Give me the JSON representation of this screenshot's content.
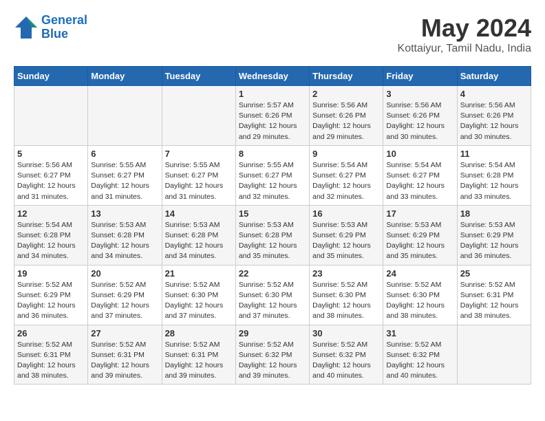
{
  "logo": {
    "line1": "General",
    "line2": "Blue"
  },
  "title": "May 2024",
  "subtitle": "Kottaiyur, Tamil Nadu, India",
  "days_of_week": [
    "Sunday",
    "Monday",
    "Tuesday",
    "Wednesday",
    "Thursday",
    "Friday",
    "Saturday"
  ],
  "weeks": [
    [
      {
        "day": "",
        "info": ""
      },
      {
        "day": "",
        "info": ""
      },
      {
        "day": "",
        "info": ""
      },
      {
        "day": "1",
        "info": "Sunrise: 5:57 AM\nSunset: 6:26 PM\nDaylight: 12 hours\nand 29 minutes."
      },
      {
        "day": "2",
        "info": "Sunrise: 5:56 AM\nSunset: 6:26 PM\nDaylight: 12 hours\nand 29 minutes."
      },
      {
        "day": "3",
        "info": "Sunrise: 5:56 AM\nSunset: 6:26 PM\nDaylight: 12 hours\nand 30 minutes."
      },
      {
        "day": "4",
        "info": "Sunrise: 5:56 AM\nSunset: 6:26 PM\nDaylight: 12 hours\nand 30 minutes."
      }
    ],
    [
      {
        "day": "5",
        "info": "Sunrise: 5:56 AM\nSunset: 6:27 PM\nDaylight: 12 hours\nand 31 minutes."
      },
      {
        "day": "6",
        "info": "Sunrise: 5:55 AM\nSunset: 6:27 PM\nDaylight: 12 hours\nand 31 minutes."
      },
      {
        "day": "7",
        "info": "Sunrise: 5:55 AM\nSunset: 6:27 PM\nDaylight: 12 hours\nand 31 minutes."
      },
      {
        "day": "8",
        "info": "Sunrise: 5:55 AM\nSunset: 6:27 PM\nDaylight: 12 hours\nand 32 minutes."
      },
      {
        "day": "9",
        "info": "Sunrise: 5:54 AM\nSunset: 6:27 PM\nDaylight: 12 hours\nand 32 minutes."
      },
      {
        "day": "10",
        "info": "Sunrise: 5:54 AM\nSunset: 6:27 PM\nDaylight: 12 hours\nand 33 minutes."
      },
      {
        "day": "11",
        "info": "Sunrise: 5:54 AM\nSunset: 6:28 PM\nDaylight: 12 hours\nand 33 minutes."
      }
    ],
    [
      {
        "day": "12",
        "info": "Sunrise: 5:54 AM\nSunset: 6:28 PM\nDaylight: 12 hours\nand 34 minutes."
      },
      {
        "day": "13",
        "info": "Sunrise: 5:53 AM\nSunset: 6:28 PM\nDaylight: 12 hours\nand 34 minutes."
      },
      {
        "day": "14",
        "info": "Sunrise: 5:53 AM\nSunset: 6:28 PM\nDaylight: 12 hours\nand 34 minutes."
      },
      {
        "day": "15",
        "info": "Sunrise: 5:53 AM\nSunset: 6:28 PM\nDaylight: 12 hours\nand 35 minutes."
      },
      {
        "day": "16",
        "info": "Sunrise: 5:53 AM\nSunset: 6:29 PM\nDaylight: 12 hours\nand 35 minutes."
      },
      {
        "day": "17",
        "info": "Sunrise: 5:53 AM\nSunset: 6:29 PM\nDaylight: 12 hours\nand 35 minutes."
      },
      {
        "day": "18",
        "info": "Sunrise: 5:53 AM\nSunset: 6:29 PM\nDaylight: 12 hours\nand 36 minutes."
      }
    ],
    [
      {
        "day": "19",
        "info": "Sunrise: 5:52 AM\nSunset: 6:29 PM\nDaylight: 12 hours\nand 36 minutes."
      },
      {
        "day": "20",
        "info": "Sunrise: 5:52 AM\nSunset: 6:29 PM\nDaylight: 12 hours\nand 37 minutes."
      },
      {
        "day": "21",
        "info": "Sunrise: 5:52 AM\nSunset: 6:30 PM\nDaylight: 12 hours\nand 37 minutes."
      },
      {
        "day": "22",
        "info": "Sunrise: 5:52 AM\nSunset: 6:30 PM\nDaylight: 12 hours\nand 37 minutes."
      },
      {
        "day": "23",
        "info": "Sunrise: 5:52 AM\nSunset: 6:30 PM\nDaylight: 12 hours\nand 38 minutes."
      },
      {
        "day": "24",
        "info": "Sunrise: 5:52 AM\nSunset: 6:30 PM\nDaylight: 12 hours\nand 38 minutes."
      },
      {
        "day": "25",
        "info": "Sunrise: 5:52 AM\nSunset: 6:31 PM\nDaylight: 12 hours\nand 38 minutes."
      }
    ],
    [
      {
        "day": "26",
        "info": "Sunrise: 5:52 AM\nSunset: 6:31 PM\nDaylight: 12 hours\nand 38 minutes."
      },
      {
        "day": "27",
        "info": "Sunrise: 5:52 AM\nSunset: 6:31 PM\nDaylight: 12 hours\nand 39 minutes."
      },
      {
        "day": "28",
        "info": "Sunrise: 5:52 AM\nSunset: 6:31 PM\nDaylight: 12 hours\nand 39 minutes."
      },
      {
        "day": "29",
        "info": "Sunrise: 5:52 AM\nSunset: 6:32 PM\nDaylight: 12 hours\nand 39 minutes."
      },
      {
        "day": "30",
        "info": "Sunrise: 5:52 AM\nSunset: 6:32 PM\nDaylight: 12 hours\nand 40 minutes."
      },
      {
        "day": "31",
        "info": "Sunrise: 5:52 AM\nSunset: 6:32 PM\nDaylight: 12 hours\nand 40 minutes."
      },
      {
        "day": "",
        "info": ""
      }
    ]
  ]
}
